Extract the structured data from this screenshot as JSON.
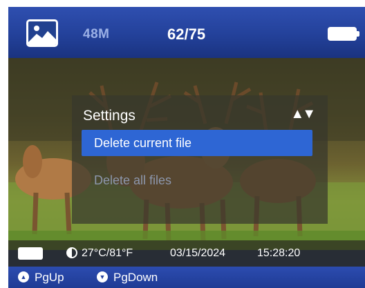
{
  "topbar": {
    "gallery_icon": "gallery-image-icon",
    "resolution": "48M",
    "file_counter": "62/75",
    "battery_icon": "battery-full-icon"
  },
  "menu": {
    "title": "Settings",
    "arrows": "▲▼",
    "items": [
      {
        "label": "Delete current file",
        "selected": true
      },
      {
        "label": "Delete all files",
        "selected": false
      }
    ]
  },
  "status": {
    "battery_icon": "battery-full-icon",
    "temperature_icon": "thermometer-icon",
    "temperature": "27°C/81°F",
    "date": "03/15/2024",
    "time": "15:28:20"
  },
  "nav": {
    "pgup_icon": "up-circle-icon",
    "pgup_label": "PgUp",
    "pgdown_icon": "down-circle-icon",
    "pgdown_label": "PgDown"
  },
  "colors": {
    "topbar_blue": "#23419a",
    "highlight_blue": "#2e66d4",
    "dim_text": "#8d97ad"
  }
}
